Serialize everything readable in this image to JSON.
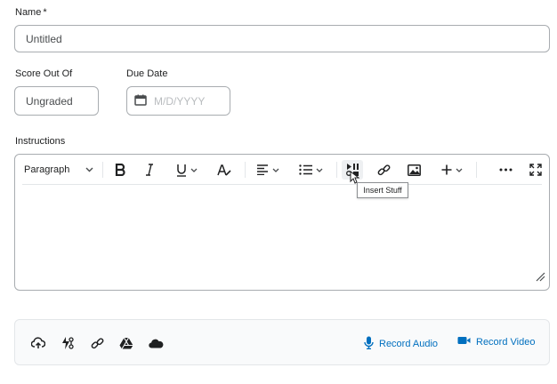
{
  "form": {
    "name_label": "Name",
    "name_required_mark": "*",
    "name_value": "Untitled",
    "score_label": "Score Out Of",
    "score_value": "Ungraded",
    "due_date_label": "Due Date",
    "due_date_placeholder": "M/D/YYYY",
    "instructions_label": "Instructions"
  },
  "editor": {
    "format_select": "Paragraph",
    "tooltip": "Insert Stuff",
    "toolbar_icons": [
      "bold-icon",
      "italic-icon",
      "underline-icon",
      "text-format-icon",
      "align-left-icon",
      "list-icon",
      "insert-stuff-icon",
      "link-icon",
      "image-icon",
      "plus-icon",
      "more-icon",
      "fullscreen-icon"
    ]
  },
  "attachments": {
    "icons": [
      "upload-icon",
      "quicklink-icon",
      "link-icon",
      "google-drive-icon",
      "onedrive-icon"
    ],
    "record_audio": "Record Audio",
    "record_video": "Record Video",
    "accent_color": "#006fbf"
  }
}
